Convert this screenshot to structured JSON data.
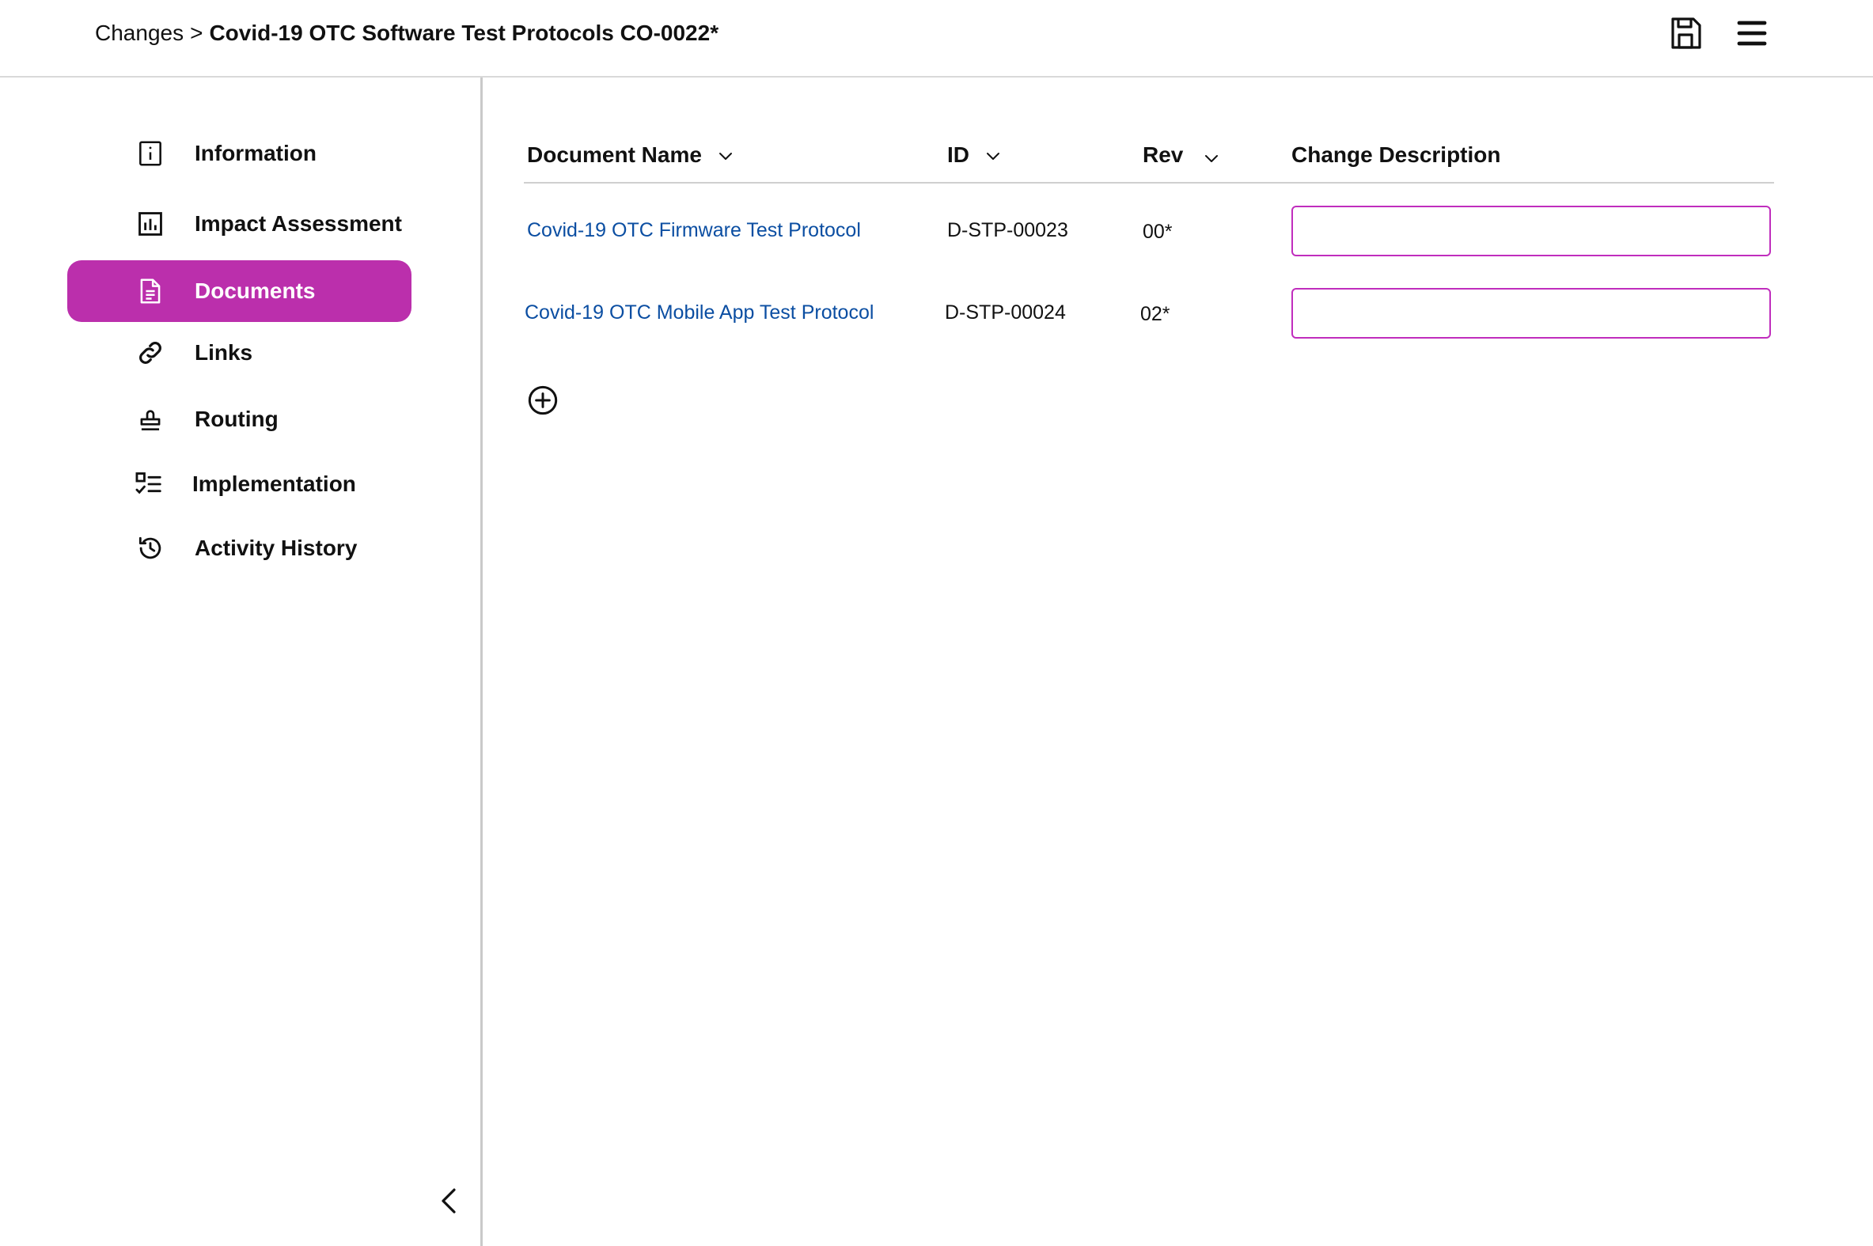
{
  "header": {
    "breadcrumb_parent": "Changes",
    "breadcrumb_separator": ">",
    "breadcrumb_current": "Covid-19 OTC Software Test Protocols CO-0022*",
    "icons": [
      "save-icon",
      "menu-icon"
    ]
  },
  "sidebar": {
    "items": [
      {
        "label": "Information",
        "icon": "info-icon",
        "active": false
      },
      {
        "label": "Impact Assessment",
        "icon": "bar-chart-icon",
        "active": false
      },
      {
        "label": "Documents",
        "icon": "document-icon",
        "active": true
      },
      {
        "label": "Links",
        "icon": "link-icon",
        "active": false
      },
      {
        "label": "Routing",
        "icon": "stamp-icon",
        "active": false
      },
      {
        "label": "Implementation",
        "icon": "checklist-icon",
        "active": false
      },
      {
        "label": "Activity History",
        "icon": "history-icon",
        "active": false
      }
    ],
    "collapse_icon": "chevron-left-icon",
    "active_color": "#bb2fac"
  },
  "table": {
    "columns": [
      {
        "label": "Document Name",
        "sortable": true
      },
      {
        "label": "ID",
        "sortable": true
      },
      {
        "label": "Rev",
        "sortable": true
      },
      {
        "label": "Change Description",
        "sortable": false
      }
    ],
    "rows": [
      {
        "name": "Covid-19 OTC Firmware Test Protocol",
        "id": "D-STP-00023",
        "rev": "00*",
        "description": ""
      },
      {
        "name": "Covid-19 OTC Mobile App Test Protocol",
        "id": "D-STP-00024",
        "rev": "02*",
        "description": ""
      }
    ],
    "add_icon": "plus-circle-icon",
    "link_color": "#0b4ea2",
    "input_border_color": "#c02dbd"
  }
}
